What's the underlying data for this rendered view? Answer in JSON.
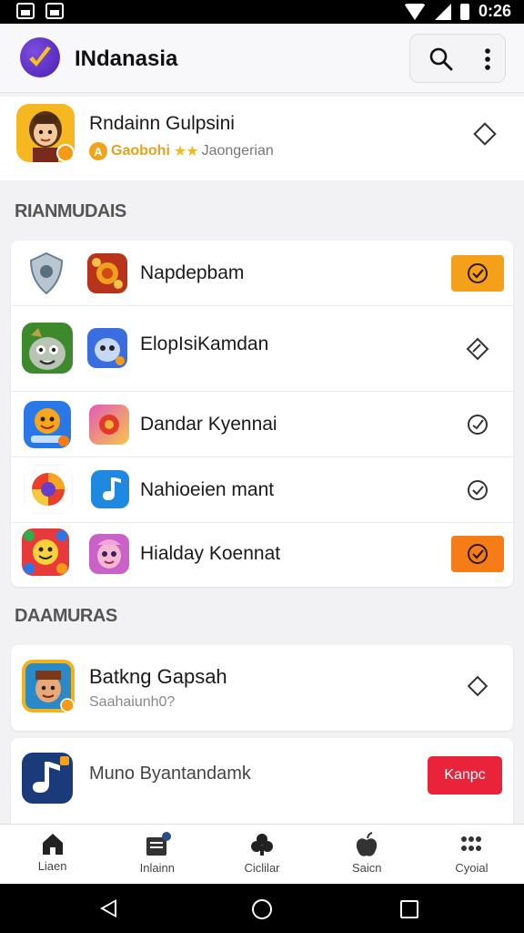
{
  "status_bar": {
    "time": "0:26"
  },
  "app_bar": {
    "title": "INdanasia",
    "icons": [
      "app-logo",
      "search-icon",
      "more-vert-icon"
    ]
  },
  "profile": {
    "name": "Rndainn Gulpsini",
    "currency_label": "Gaobohi",
    "coin_glyph": "A",
    "stars": "★★",
    "rank_text": "Jaongerian"
  },
  "sections": {
    "first": "RIANMUDAIS",
    "second": "DAAMURAS"
  },
  "list1": [
    {
      "label": "Napdepbam",
      "action": "orange-check"
    },
    {
      "label": "ElopIsiKamdan",
      "action": "ghost-edit"
    },
    {
      "label": "Dandar Kyennai",
      "action": "ghost-check"
    },
    {
      "label": "Nahioeien mant",
      "action": "ghost-check"
    },
    {
      "label": "Hialday Koennat",
      "action": "orange-check"
    }
  ],
  "list2": {
    "item1": {
      "title": "Batkng Gapsah",
      "subtitle": "Saahaiunh0?"
    },
    "item2": {
      "title": "Muno Byantandamk",
      "button_label": "Kanpc"
    }
  },
  "tabs": [
    {
      "label": "Liaen",
      "icon": "home-icon"
    },
    {
      "label": "Inlainn",
      "icon": "inbox-icon",
      "badge": "2"
    },
    {
      "label": "Ciclilar",
      "icon": "clubs-icon"
    },
    {
      "label": "Saicn",
      "icon": "apple-icon"
    },
    {
      "label": "Cyoial",
      "icon": "grid-icon"
    }
  ],
  "colors": {
    "accent_orange": "#f5a01a",
    "deep_orange": "#f57c16",
    "red_button": "#e8233a",
    "logo_purple": "#5a2bc6"
  }
}
